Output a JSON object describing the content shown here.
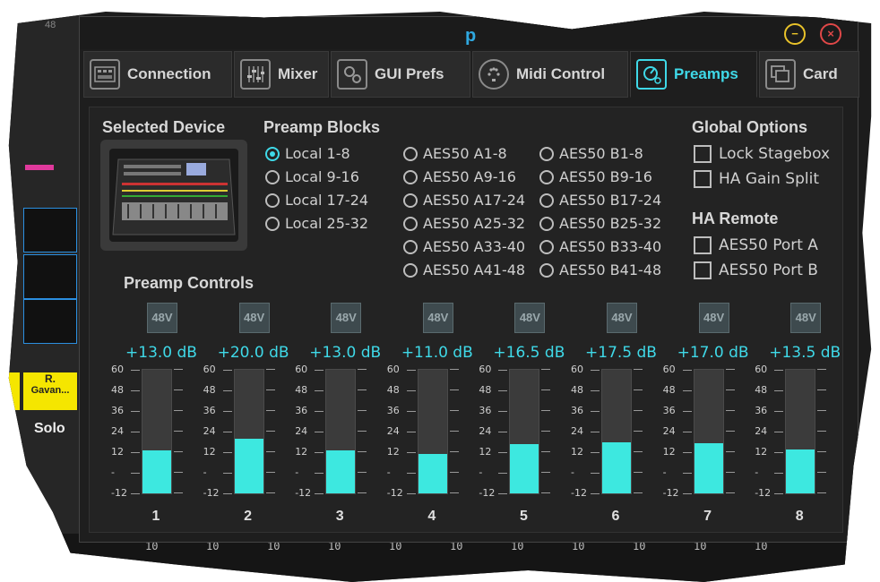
{
  "daw": {
    "top_num": "48",
    "yellow_label_1": "R.",
    "yellow_label_2": "Gavan...",
    "solo": "Solo",
    "bottom_labels": [
      "10",
      "10",
      "10",
      "10",
      "10",
      "10",
      "10",
      "10",
      "10",
      "10",
      "10"
    ]
  },
  "window": {
    "title_fragment": "p",
    "minimize_glyph": "−",
    "close_glyph": "×"
  },
  "tabs": [
    {
      "label": "Connection",
      "icon": "connection-icon"
    },
    {
      "label": "Mixer",
      "icon": "mixer-icon"
    },
    {
      "label": "GUI Prefs",
      "icon": "gear-icon"
    },
    {
      "label": "Midi Control",
      "icon": "midi-icon"
    },
    {
      "label": "Preamps",
      "icon": "preamp-knob-icon",
      "active": true
    },
    {
      "label": "Card",
      "icon": "card-icon"
    }
  ],
  "selected_device": {
    "heading": "Selected Device"
  },
  "preamp_blocks": {
    "heading": "Preamp Blocks",
    "selected": "Local 1-8",
    "col1": [
      "Local 1-8",
      "Local 9-16",
      "Local 17-24",
      "Local 25-32"
    ],
    "col2": [
      "AES50 A1-8",
      "AES50 A9-16",
      "AES50 A17-24",
      "AES50 A25-32",
      "AES50 A33-40",
      "AES50 A41-48"
    ],
    "col3": [
      "AES50 B1-8",
      "AES50 B9-16",
      "AES50 B17-24",
      "AES50 B25-32",
      "AES50 B33-40",
      "AES50 B41-48"
    ]
  },
  "global_options": {
    "heading": "Global Options",
    "items": [
      "Lock Stagebox",
      "HA Gain Split"
    ]
  },
  "ha_remote": {
    "heading": "HA Remote",
    "items": [
      "AES50 Port A",
      "AES50 Port B"
    ]
  },
  "preamp_controls": {
    "heading": "Preamp Controls",
    "phantom_label": "48V",
    "scale": [
      "60",
      "48",
      "36",
      "24",
      "12",
      "-",
      "-12"
    ],
    "scale_min": -12,
    "scale_max": 60,
    "channels": [
      {
        "num": "1",
        "gain": "+13.0 dB",
        "value": 13.0
      },
      {
        "num": "2",
        "gain": "+20.0 dB",
        "value": 20.0
      },
      {
        "num": "3",
        "gain": "+13.0 dB",
        "value": 13.0
      },
      {
        "num": "4",
        "gain": "+11.0 dB",
        "value": 11.0
      },
      {
        "num": "5",
        "gain": "+16.5 dB",
        "value": 16.5
      },
      {
        "num": "6",
        "gain": "+17.5 dB",
        "value": 17.5
      },
      {
        "num": "7",
        "gain": "+17.0 dB",
        "value": 17.0
      },
      {
        "num": "8",
        "gain": "+13.5 dB",
        "value": 13.5
      }
    ]
  },
  "colors": {
    "accent": "#3fd9e8",
    "meter_fill": "#3de8e0"
  }
}
